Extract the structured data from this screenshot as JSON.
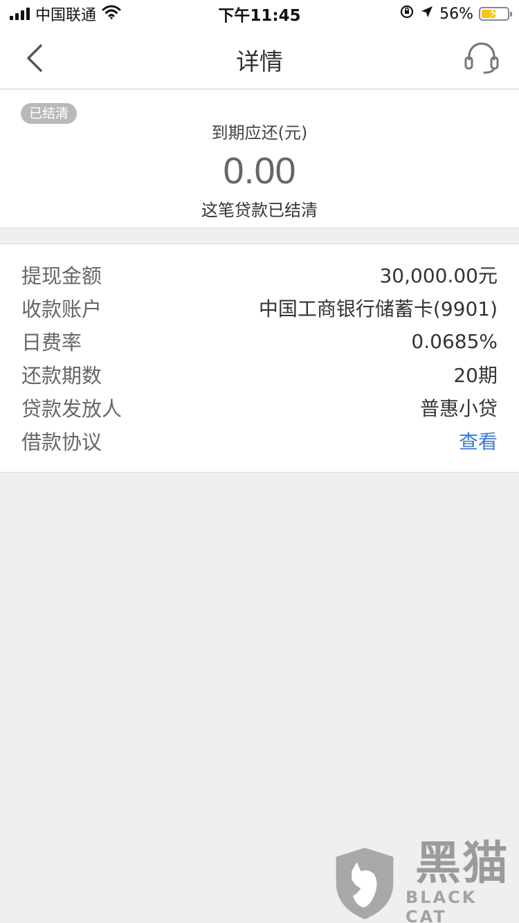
{
  "status_bar": {
    "carrier": "中国联通",
    "time": "下午11:45",
    "battery": "56%",
    "battery_level": 0.56
  },
  "nav": {
    "title": "详情"
  },
  "summary": {
    "badge": "已结清",
    "label": "到期应还(元)",
    "amount": "0.00",
    "note": "这笔贷款已结清"
  },
  "details": [
    {
      "label": "提现金额",
      "value": "30,000.00元"
    },
    {
      "label": "收款账户",
      "value": "中国工商银行储蓄卡(9901)"
    },
    {
      "label": "日费率",
      "value": "0.0685%"
    },
    {
      "label": "还款期数",
      "value": "20期"
    },
    {
      "label": "贷款发放人",
      "value": "普惠小贷"
    },
    {
      "label": "借款协议",
      "value": "查看"
    }
  ],
  "watermark": {
    "cn": "黑猫",
    "en": "BLACK CAT"
  },
  "colors": {
    "link": "#3a7bd5",
    "badge_bg": "#b9b9b9",
    "page_bg": "#efefef",
    "battery_fill": "#f5c518"
  }
}
